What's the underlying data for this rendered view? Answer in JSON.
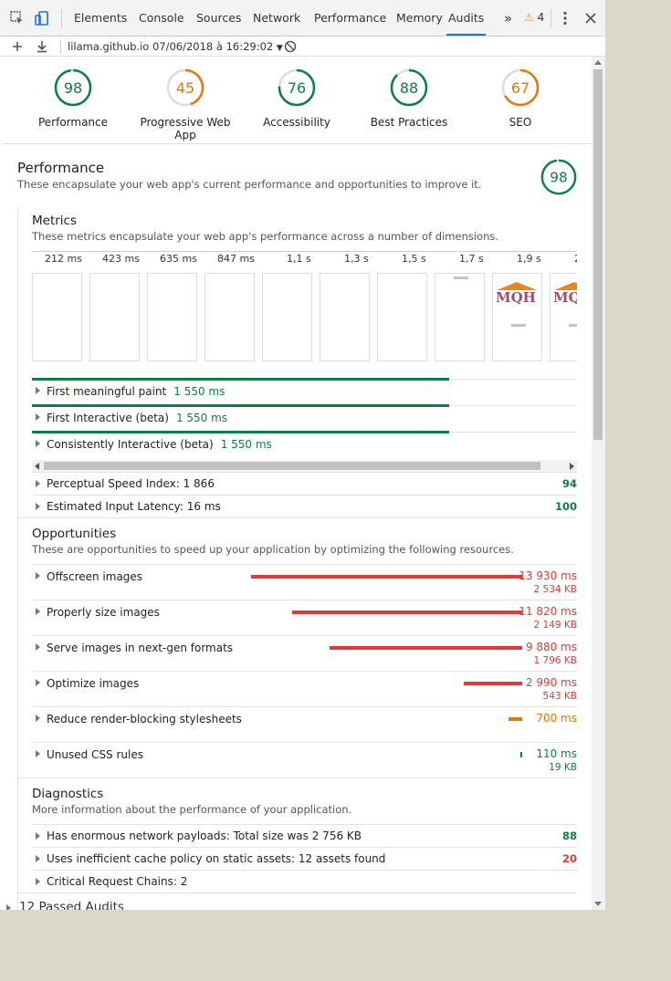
{
  "toolbar": {
    "tabs": [
      "Elements",
      "Console",
      "Sources",
      "Network",
      "Performance",
      "Memory",
      "Audits"
    ],
    "active_tab": "Audits",
    "overflow": "»",
    "warning_count": "4"
  },
  "report": {
    "selector_label": "lilama.github.io 07/06/2018 à 16:29:02"
  },
  "gauges": [
    {
      "score": "98",
      "label": "Performance",
      "color": "#0b8043",
      "fraction": 0.98
    },
    {
      "score": "45",
      "label": "Progressive Web App",
      "color": "#e67700",
      "fraction": 0.45
    },
    {
      "score": "76",
      "label": "Accessibility",
      "color": "#0b8043",
      "fraction": 0.76
    },
    {
      "score": "88",
      "label": "Best Practices",
      "color": "#0b8043",
      "fraction": 0.88
    },
    {
      "score": "67",
      "label": "SEO",
      "color": "#e67700",
      "fraction": 0.67
    }
  ],
  "performance": {
    "title": "Performance",
    "description": "These encapsulate your web app's current performance and opportunities to improve it.",
    "score": "98",
    "metrics": {
      "title": "Metrics",
      "description": "These metrics encapsulate your web app's performance across a number of dimensions.",
      "filmstrip_ticks": [
        "212 ms",
        "423 ms",
        "635 ms",
        "847 ms",
        "1,1 s",
        "1,3 s",
        "1,5 s",
        "1,7 s",
        "1,9 s",
        "2"
      ],
      "timed": [
        {
          "label": "First meaningful paint",
          "value": "1 550 ms"
        },
        {
          "label": "First Interactive (beta)",
          "value": "1 550 ms"
        },
        {
          "label": "Consistently Interactive (beta)",
          "value": "1 550 ms"
        }
      ],
      "scored": [
        {
          "label": "Perceptual Speed Index: 1 866",
          "score": "94"
        },
        {
          "label": "Estimated Input Latency: 16 ms",
          "score": "100"
        }
      ]
    },
    "opportunities": {
      "title": "Opportunities",
      "description": "These are opportunities to speed up your application by optimizing the following resources.",
      "items": [
        {
          "label": "Offscreen images",
          "ms": "13 930 ms",
          "kb": "2 534 KB",
          "ms_value": 13930,
          "color": "#e53935"
        },
        {
          "label": "Properly size images",
          "ms": "11 820 ms",
          "kb": "2 149 KB",
          "ms_value": 11820,
          "color": "#e53935"
        },
        {
          "label": "Serve images in next-gen formats",
          "ms": "9 880 ms",
          "kb": "1 796 KB",
          "ms_value": 9880,
          "color": "#e53935"
        },
        {
          "label": "Optimize images",
          "ms": "2 990 ms",
          "kb": "543 KB",
          "ms_value": 2990,
          "color": "#e53935"
        },
        {
          "label": "Reduce render-blocking stylesheets",
          "ms": "700 ms",
          "kb": "",
          "ms_value": 700,
          "color": "#e67700"
        },
        {
          "label": "Unused CSS rules",
          "ms": "110 ms",
          "kb": "19 KB",
          "ms_value": 110,
          "color": "#0b8043"
        }
      ]
    },
    "diagnostics": {
      "title": "Diagnostics",
      "description": "More information about the performance of your application.",
      "items": [
        {
          "label": "Has enormous network payloads: Total size was 2 756 KB",
          "score": "88",
          "color": "#0b8043"
        },
        {
          "label": "Uses inefficient cache policy on static assets: 12 assets found",
          "score": "20",
          "color": "#e53935"
        },
        {
          "label": "Critical Request Chains: 2",
          "score": "",
          "color": ""
        }
      ]
    },
    "passed_audits": "12 Passed Audits"
  }
}
